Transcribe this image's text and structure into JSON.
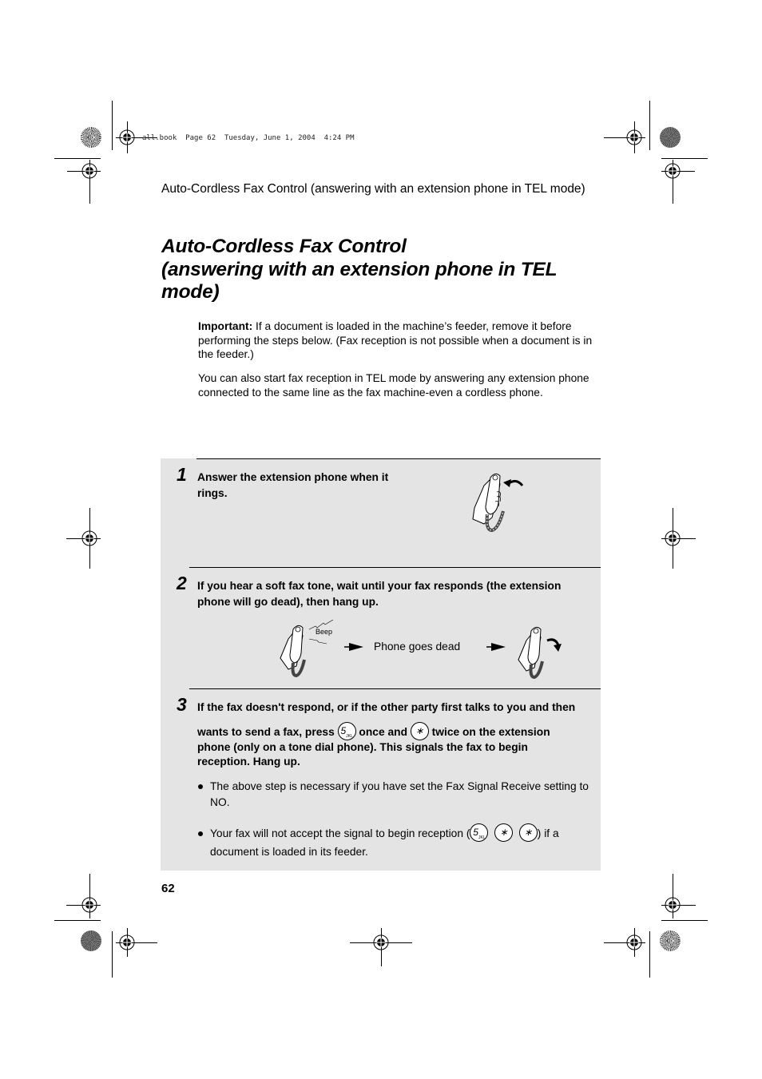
{
  "print_header": "all.book  Page 62  Tuesday, June 1, 2004  4:24 PM",
  "running_head": "Auto-Cordless Fax Control (answering with an extension phone in TEL mode)",
  "title": {
    "line1": "Auto-Cordless Fax Control",
    "line2": "(answering with an extension phone in TEL",
    "line3": "mode)"
  },
  "intro": {
    "important_label": "Important:",
    "important_text": " If a document is loaded in the machine’s feeder, remove it before performing the steps below. (Fax reception is not possible when a document is in the feeder.)",
    "paragraph": "You can also start fax reception in TEL mode by answering any extension phone connected to the same line as the fax machine-even a cordless phone."
  },
  "steps": [
    {
      "number": "1",
      "text": "Answer the extension phone when it rings.",
      "illustration": "hand-lifting-handset-icon"
    },
    {
      "number": "2",
      "text": "If you hear a soft fax tone, wait until your fax responds (the extension phone will go dead), then hang up.",
      "flow": {
        "beep_label": "Beep",
        "middle_label": "Phone goes dead"
      }
    },
    {
      "number": "3",
      "text_part1": "If the fax doesn't respond, or if the other party first talks to you and then",
      "text_part2a": "wants to send a fax, press ",
      "text_part2b": " once and ",
      "text_part2c": " twice on the extension",
      "text_part3": "phone (only on a tone dial phone). This signals the fax to begin reception. Hang up.",
      "keys": {
        "five": "5",
        "five_sub": "JKL",
        "star": "∗"
      },
      "bullets": [
        {
          "text": "The above step is necessary if you have set the Fax Signal Receive setting to NO."
        },
        {
          "text_before": "Your fax will not accept the signal to begin reception (",
          "text_after": ") if a document is loaded in its feeder."
        }
      ]
    }
  ],
  "page_number": "62"
}
